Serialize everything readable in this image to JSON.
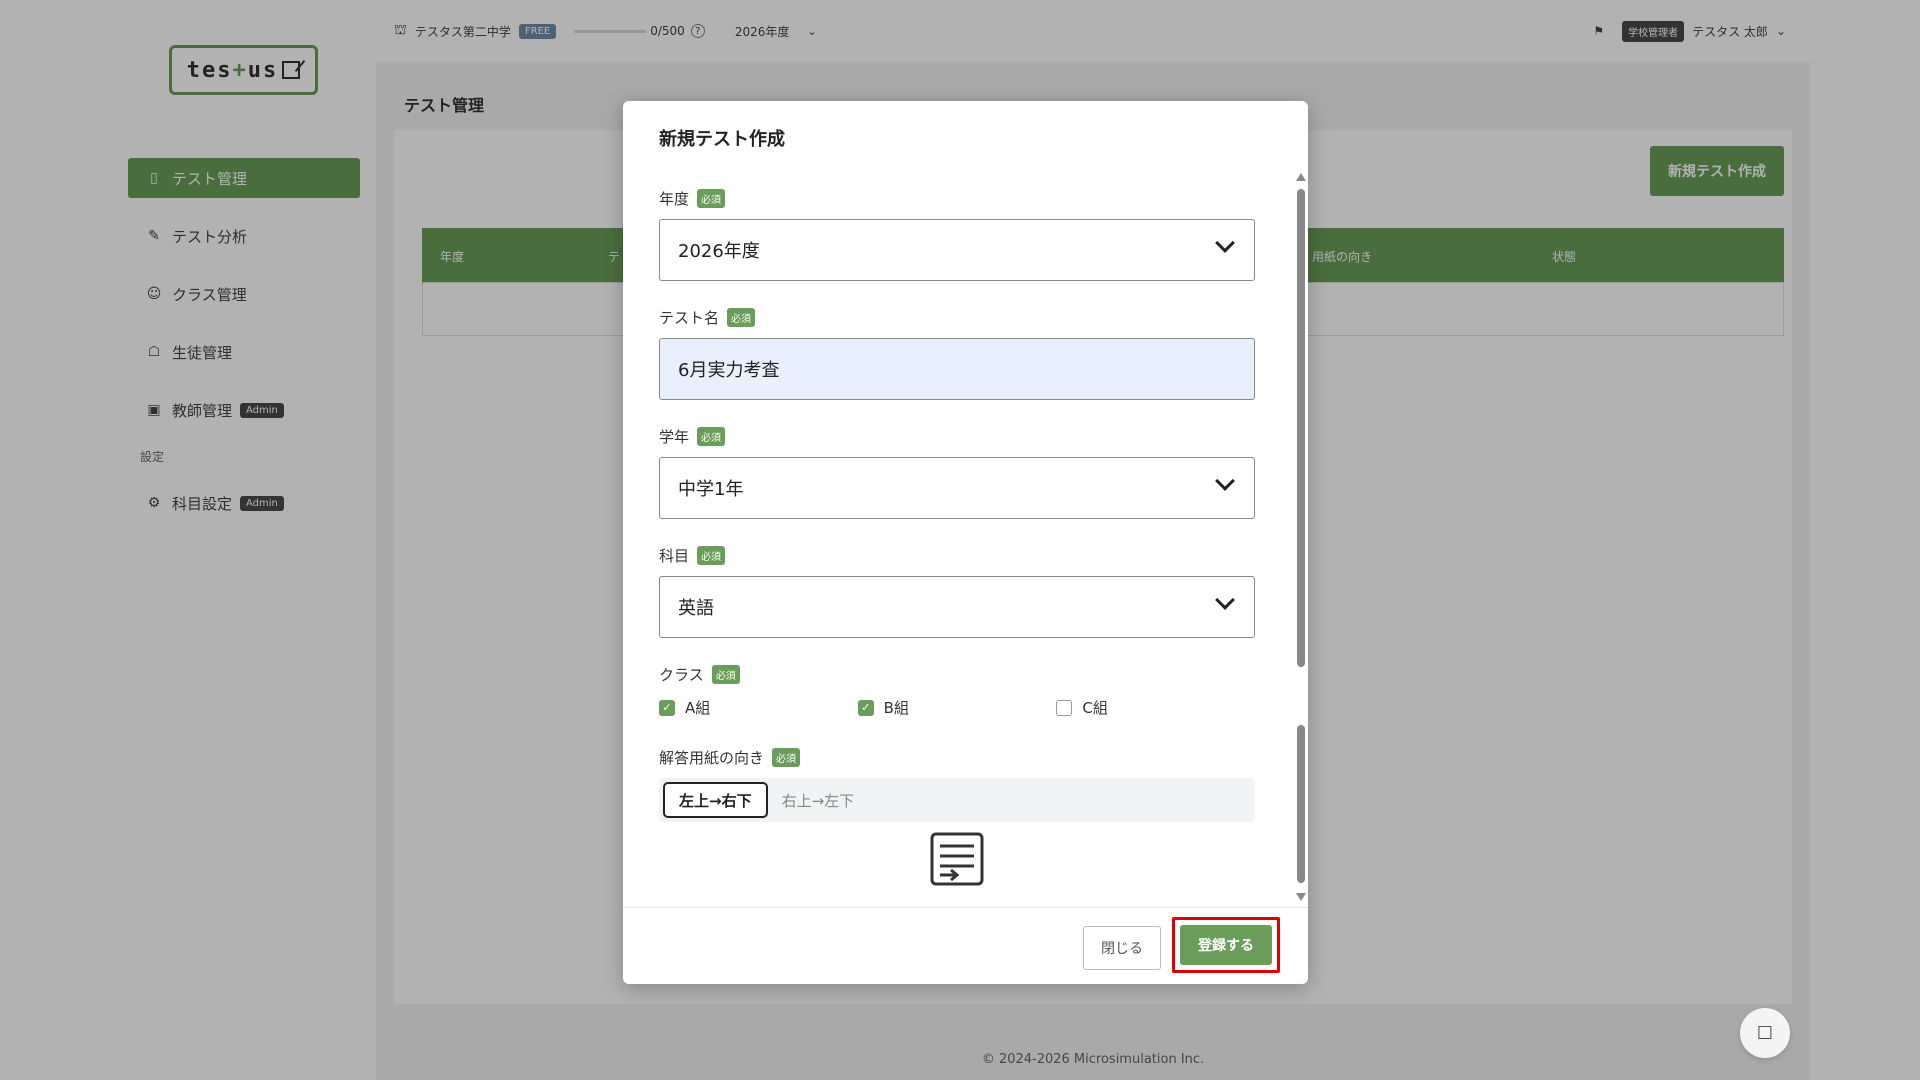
{
  "app": {
    "logo_text_pre": "tes",
    "logo_text_plus": "+",
    "logo_text_post": "us"
  },
  "topbar": {
    "school_name": "テスタス第二中学",
    "plan_badge": "FREE",
    "usage": "0/500",
    "year": "2026年度",
    "role": "学校管理者",
    "user_name": "テスタス 太郎"
  },
  "sidebar": {
    "items": [
      {
        "label": "テスト管理",
        "icon": "document-icon"
      },
      {
        "label": "テスト分析",
        "icon": "analysis-icon"
      },
      {
        "label": "クラス管理",
        "icon": "group-icon"
      },
      {
        "label": "生徒管理",
        "icon": "student-icon"
      },
      {
        "label": "教師管理",
        "icon": "teacher-icon",
        "badge": "Admin"
      }
    ],
    "section_label": "設定",
    "settings_items": [
      {
        "label": "科目設定",
        "icon": "gear-icon",
        "badge": "Admin"
      }
    ]
  },
  "main": {
    "page_title": "テスト管理",
    "new_button": "新規テスト作成",
    "table_headers": [
      "年度",
      "テ",
      "用紙の向き",
      "状態"
    ]
  },
  "footer": {
    "copyright": "© 2024-2026 Microsimulation Inc."
  },
  "modal": {
    "title": "新規テスト作成",
    "required_badge": "必須",
    "year_label": "年度",
    "year_value": "2026年度",
    "test_name_label": "テスト名",
    "test_name_value": "6月実力考査",
    "grade_label": "学年",
    "grade_value": "中学1年",
    "subject_label": "科目",
    "subject_value": "英語",
    "class_label": "クラス",
    "classes": [
      {
        "label": "A組",
        "checked": true
      },
      {
        "label": "B組",
        "checked": true
      },
      {
        "label": "C組",
        "checked": false
      }
    ],
    "orientation_label": "解答用紙の向き",
    "orientation_options": [
      "左上→右下",
      "右上→左下"
    ],
    "orientation_selected": "左上→右下",
    "close_button": "閉じる",
    "submit_button": "登録する"
  },
  "colors": {
    "accent": "#6a9c5a",
    "highlight": "#e00000"
  }
}
